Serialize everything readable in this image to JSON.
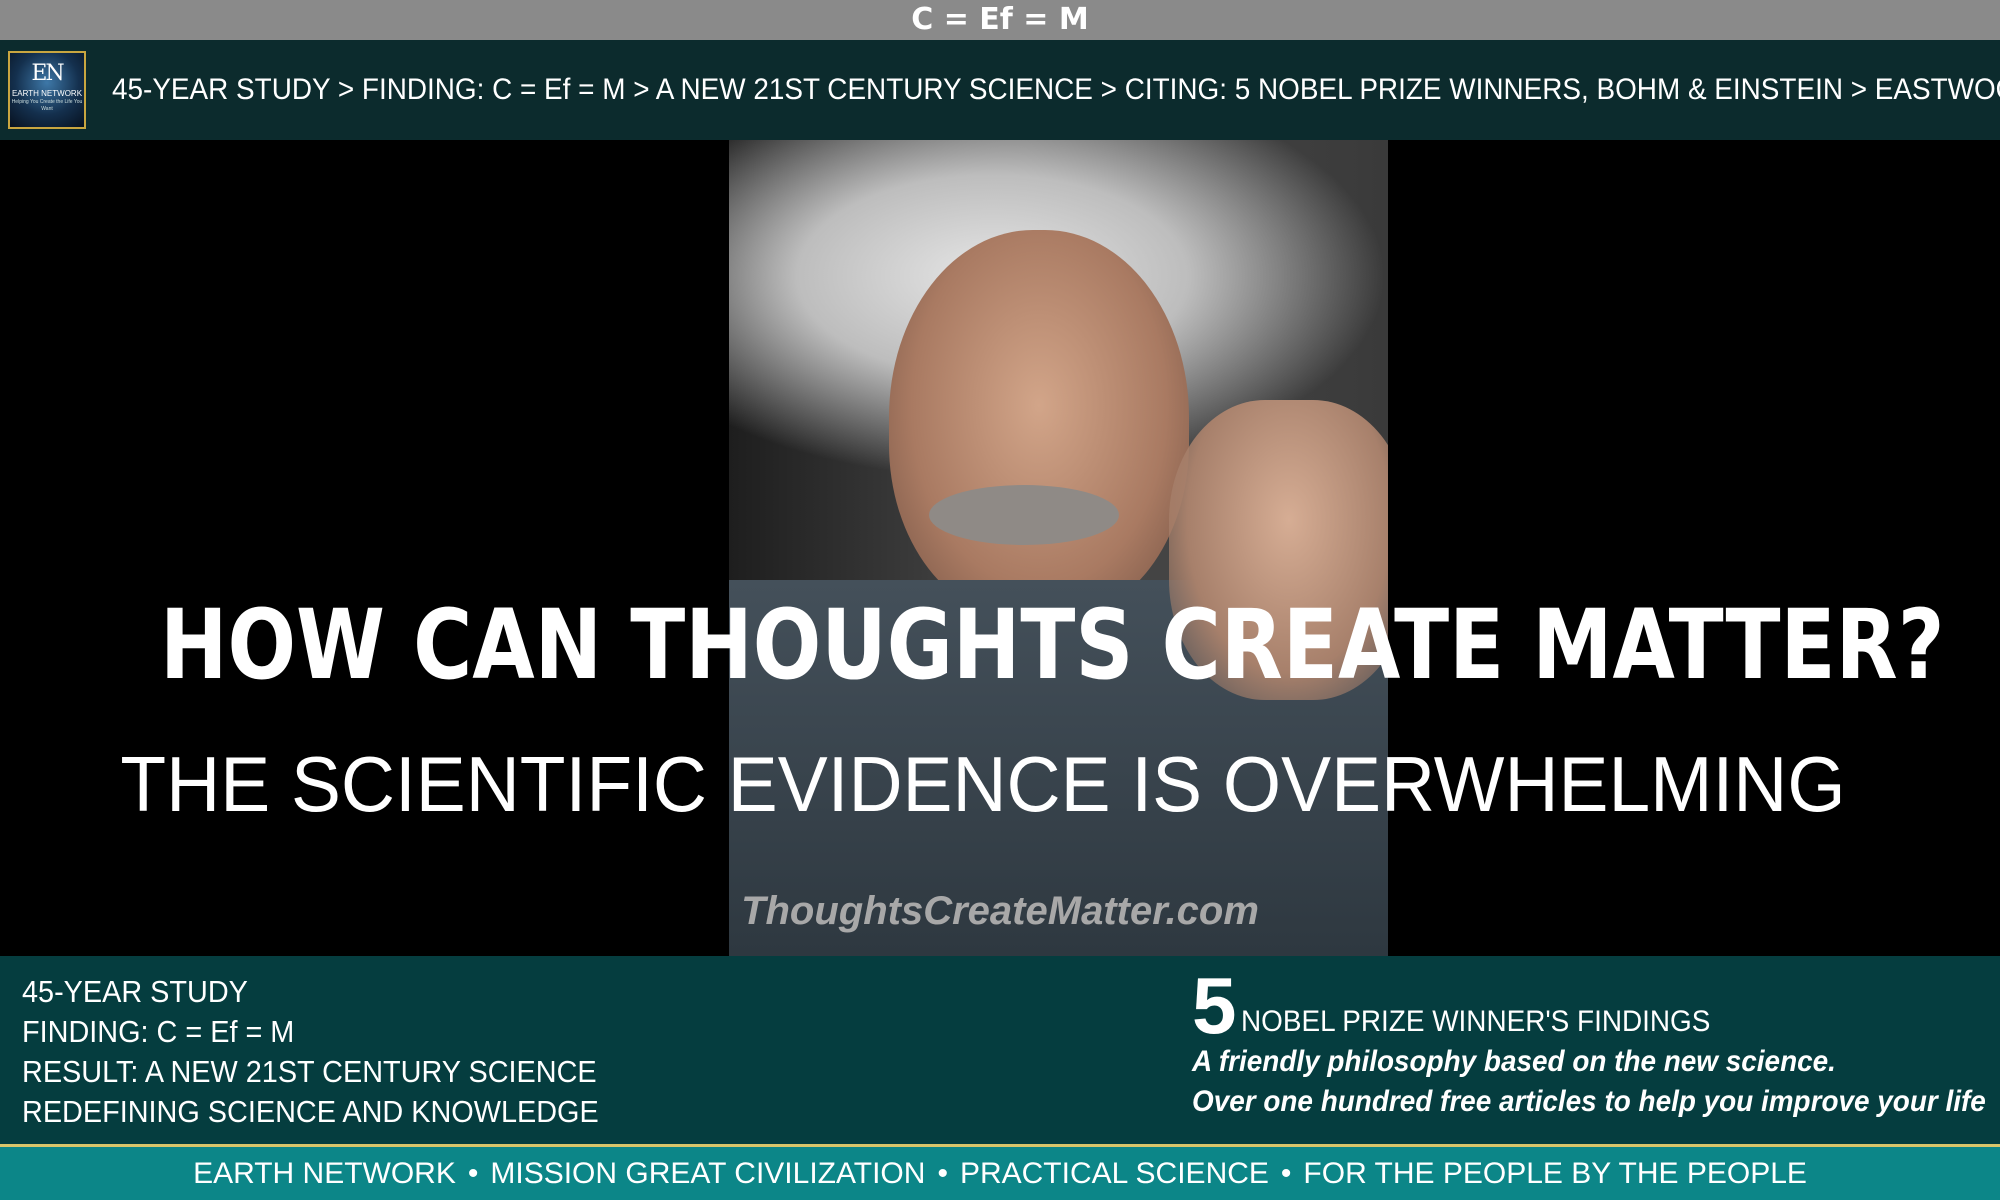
{
  "title_bar": {
    "text": "C = Ef = M"
  },
  "logo": {
    "mark": "EN",
    "name": "EARTH NETWORK",
    "tagline": "Helping You Create the Life You Want"
  },
  "breadcrumb": {
    "text": "45-YEAR STUDY > FINDING: C = Ef = M > A NEW 21ST CENTURY SCIENCE > CITING: 5 NOBEL PRIZE WINNERS, BOHM & EINSTEIN > EASTWOOD"
  },
  "hero": {
    "headline": "HOW CAN THOUGHTS CREATE MATTER?",
    "subheadline": "THE SCIENTIFIC EVIDENCE IS OVERWHELMING",
    "watermark": "ThoughtsCreateMatter.com"
  },
  "info": {
    "left_lines": [
      "45-YEAR STUDY",
      "FINDING: C = Ef = M",
      "RESULT: A NEW 21ST CENTURY SCIENCE",
      "REDEFINING SCIENCE AND KNOWLEDGE"
    ],
    "nobel_number": "5",
    "nobel_text": "NOBEL PRIZE WINNER'S FINDINGS",
    "taglines": [
      "A friendly philosophy based on the new science.",
      "Over one hundred free articles to help you improve your life"
    ]
  },
  "footer": {
    "items": [
      "EARTH NETWORK",
      "MISSION GREAT CIVILIZATION",
      "PRACTICAL SCIENCE",
      "FOR THE PEOPLE BY THE PEOPLE"
    ],
    "separator": "•"
  },
  "colors": {
    "title_bar": "#8a8a8a",
    "top_band": "#0c2b2d",
    "info_band": "#053d3f",
    "footer": "#0c8688",
    "footer_border": "#d9c56a",
    "logo_border": "#c9a640"
  }
}
